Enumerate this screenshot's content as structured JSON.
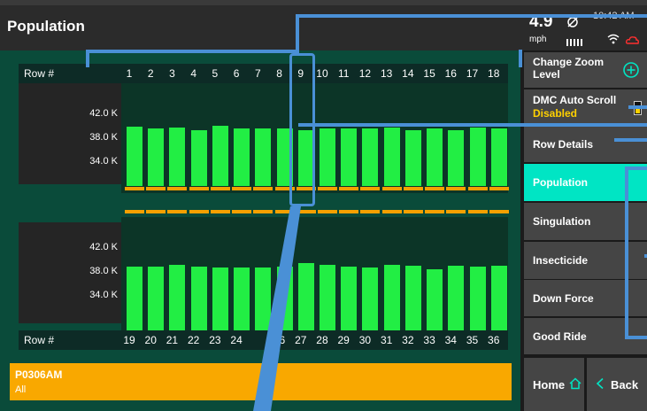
{
  "header": {
    "title": "Population",
    "speed_value": "4.9",
    "speed_unit": "mph",
    "time": "10:42 AM"
  },
  "top_panel": {
    "row_label": "Row #",
    "rows": [
      "1",
      "2",
      "3",
      "4",
      "5",
      "6",
      "7",
      "8",
      "9",
      "10",
      "11",
      "12",
      "13",
      "14",
      "15",
      "16",
      "17",
      "18"
    ],
    "y_ticks": [
      "42.0 K",
      "38.0 K",
      "34.0 K"
    ]
  },
  "bottom_panel": {
    "row_label": "Row #",
    "rows": [
      "19",
      "20",
      "21",
      "22",
      "23",
      "24",
      "",
      "26",
      "27",
      "28",
      "29",
      "30",
      "31",
      "32",
      "33",
      "34",
      "35",
      "36"
    ],
    "y_ticks": [
      "42.0 K",
      "38.0 K",
      "34.0 K"
    ]
  },
  "chart_data": {
    "type": "bar",
    "top_series": {
      "name": "",
      "categories": [
        "1",
        "2",
        "3",
        "4",
        "5",
        "6",
        "7",
        "8",
        "9",
        "10",
        "11",
        "12",
        "13",
        "14",
        "15",
        "16",
        "17",
        "18"
      ],
      "values": [
        38.1,
        37.8,
        38.0,
        37.6,
        38.2,
        37.9,
        37.8,
        37.9,
        37.6,
        37.9,
        37.9,
        37.9,
        38.0,
        37.6,
        37.8,
        37.6,
        38.0,
        37.9
      ]
    },
    "bottom_series": {
      "name": "",
      "categories": [
        "19",
        "20",
        "21",
        "22",
        "23",
        "24",
        "25",
        "26",
        "27",
        "28",
        "29",
        "30",
        "31",
        "32",
        "33",
        "34",
        "35",
        "36"
      ],
      "values": [
        37.9,
        37.9,
        38.1,
        37.9,
        37.8,
        37.8,
        37.8,
        37.9,
        38.3,
        38.1,
        37.9,
        37.8,
        38.1,
        38.0,
        37.6,
        38.0,
        37.9,
        38.0
      ]
    },
    "ylim": [
      30,
      44
    ]
  },
  "alert": {
    "code": "P0306AM",
    "sub": "All"
  },
  "sidebar": {
    "zoom": "Change Zoom Level",
    "dmc_title": "DMC Auto Scroll",
    "dmc_status": "Disabled",
    "row_details": "Row Details",
    "population": "Population",
    "singulation": "Singulation",
    "insecticide": "Insecticide",
    "down_force": "Down Force",
    "good_ride": "Good Ride",
    "home": "Home",
    "back": "Back"
  },
  "colors": {
    "accent": "#00e5c4",
    "bar": "#22ee44",
    "alert": "#f9a800",
    "dmc_status": "#ffd100"
  }
}
